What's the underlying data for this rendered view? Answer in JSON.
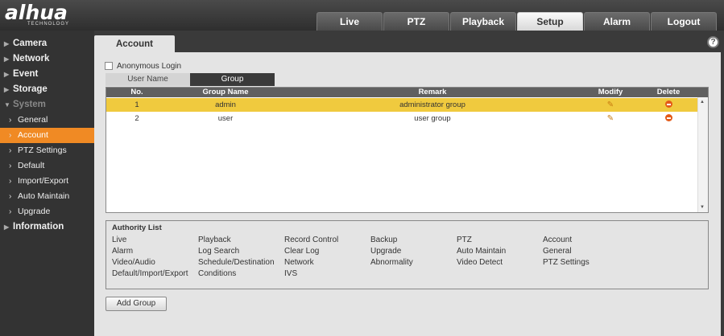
{
  "brand": {
    "logo": "alhua",
    "tagline": "TECHNOLOGY"
  },
  "nav": {
    "tabs": [
      {
        "label": "Live",
        "active": false
      },
      {
        "label": "PTZ",
        "active": false
      },
      {
        "label": "Playback",
        "active": false
      },
      {
        "label": "Setup",
        "active": true
      },
      {
        "label": "Alarm",
        "active": false
      },
      {
        "label": "Logout",
        "active": false
      }
    ]
  },
  "sidebar": {
    "items": [
      {
        "label": "Camera",
        "type": "category"
      },
      {
        "label": "Network",
        "type": "category"
      },
      {
        "label": "Event",
        "type": "category"
      },
      {
        "label": "Storage",
        "type": "category"
      },
      {
        "label": "System",
        "type": "category-open"
      },
      {
        "label": "General",
        "type": "sub"
      },
      {
        "label": "Account",
        "type": "sub-active"
      },
      {
        "label": "PTZ Settings",
        "type": "sub"
      },
      {
        "label": "Default",
        "type": "sub"
      },
      {
        "label": "Import/Export",
        "type": "sub"
      },
      {
        "label": "Auto Maintain",
        "type": "sub"
      },
      {
        "label": "Upgrade",
        "type": "sub"
      },
      {
        "label": "Information",
        "type": "category"
      }
    ]
  },
  "content": {
    "tab_label": "Account",
    "help_label": "?",
    "anonymous_label": "Anonymous Login",
    "subtabs": {
      "user": "User Name",
      "group": "Group"
    },
    "table": {
      "headers": {
        "no": "No.",
        "name": "Group Name",
        "remark": "Remark",
        "modify": "Modify",
        "delete": "Delete"
      },
      "rows": [
        {
          "no": "1",
          "name": "admin",
          "remark": "administrator group",
          "selected": true
        },
        {
          "no": "2",
          "name": "user",
          "remark": "user group",
          "selected": false
        }
      ]
    },
    "authority": {
      "title": "Authority List",
      "items": [
        "Live",
        "Playback",
        "Record Control",
        "Backup",
        "PTZ",
        "Account",
        "Alarm",
        "Log Search",
        "Clear Log",
        "Upgrade",
        "Auto Maintain",
        "General",
        "Video/Audio",
        "Schedule/Destination",
        "Network",
        "Abnormality",
        "Video Detect",
        "PTZ Settings",
        "Default/Import/Export",
        "Conditions",
        "IVS"
      ]
    },
    "add_group_label": "Add Group"
  },
  "colors": {
    "accent": "#f08a24",
    "selected_row": "#f0ca3e",
    "delete_icon": "#e35a18"
  }
}
